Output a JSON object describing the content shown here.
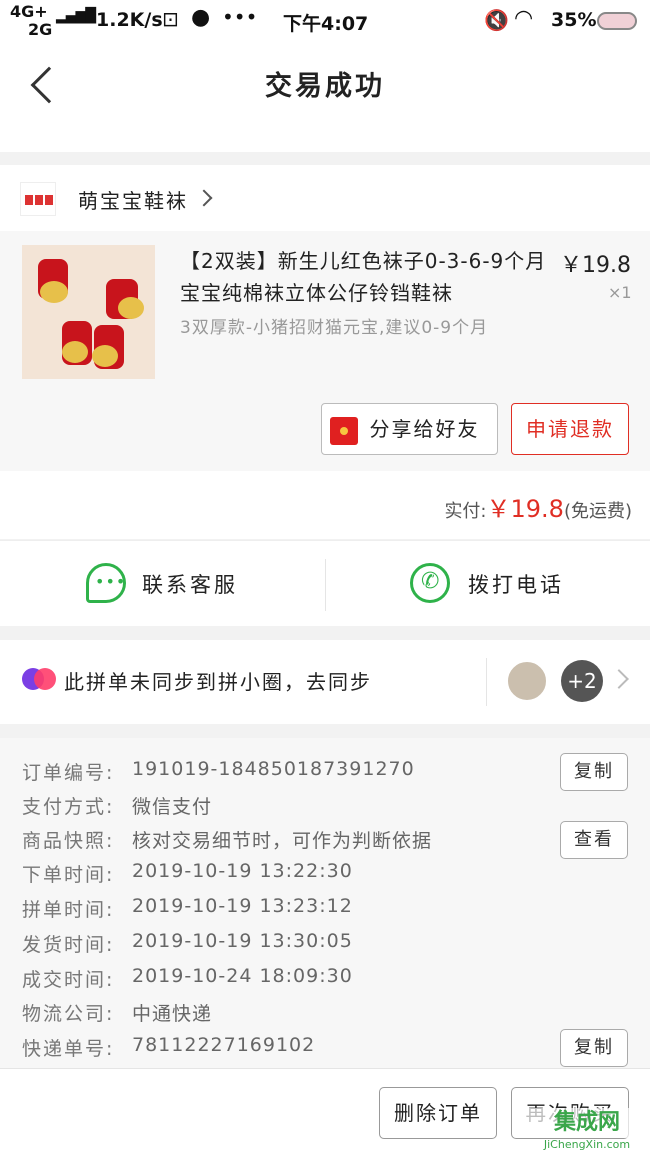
{
  "status_bar": {
    "network_1": "4G+",
    "network_2": "2G",
    "speed": "1.2K/s",
    "time": "下午4:07",
    "battery": "35%"
  },
  "header": {
    "title": "交易成功"
  },
  "shop": {
    "name": "萌宝宝鞋袜"
  },
  "product": {
    "title": "【2双装】新生儿红色袜子0-3-6-9个月宝宝纯棉袜立体公仔铃铛鞋袜",
    "spec": "3双厚款-小猪招财猫元宝,建议0-9个月",
    "price": "￥19.8",
    "quantity": "×1"
  },
  "actions": {
    "share_label": "分享给好友",
    "refund_label": "申请退款"
  },
  "payment": {
    "label": "实付:",
    "amount": "￥19.8",
    "shipping": "(免运费)"
  },
  "contact": {
    "service_label": "联系客服",
    "phone_label": "拨打电话"
  },
  "sync": {
    "text": "此拼单未同步到拼小圈，去同步",
    "extra_count": "+2"
  },
  "order_info": {
    "rows": [
      {
        "label": "订单编号:",
        "value": "191019-184850187391270"
      },
      {
        "label": "支付方式:",
        "value": "微信支付"
      },
      {
        "label": "商品快照:",
        "value": "核对交易细节时，可作为判断依据"
      },
      {
        "label": "下单时间:",
        "value": "2019-10-19 13:22:30"
      },
      {
        "label": "拼单时间:",
        "value": "2019-10-19 13:23:12"
      },
      {
        "label": "发货时间:",
        "value": "2019-10-19 13:30:05"
      },
      {
        "label": "成交时间:",
        "value": "2019-10-24 18:09:30"
      },
      {
        "label": "物流公司:",
        "value": "中通快递"
      },
      {
        "label": "快递单号:",
        "value": "78112227169102"
      }
    ],
    "copy_label": "复制",
    "view_label": "查看",
    "copy_label_2": "复制"
  },
  "footer": {
    "delete_label": "删除订单",
    "rebuy_label": "再次购买"
  },
  "watermark": {
    "text": "集成网",
    "sub": "JiChengXin.com"
  },
  "colors": {
    "accent": "#e02e24",
    "green": "#2fb24a"
  }
}
